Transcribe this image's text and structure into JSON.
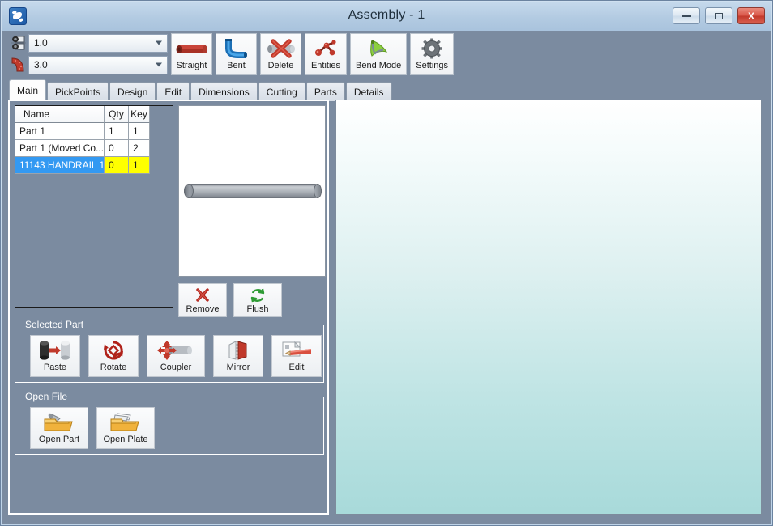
{
  "window": {
    "title": "Assembly - 1",
    "app_icon": "puzzle-piece-icon",
    "controls": {
      "minimize": "minimize-icon",
      "maximize": "restore-icon",
      "close": "X"
    }
  },
  "toolbar": {
    "combos": [
      {
        "icon": "pipe-diameter-icon",
        "value": "1.0"
      },
      {
        "icon": "bend-radius-icon",
        "value": "3.0"
      }
    ],
    "buttons": [
      {
        "label": "Straight",
        "icon": "straight-pipe-icon"
      },
      {
        "label": "Bent",
        "icon": "bent-pipe-icon"
      },
      {
        "label": "Delete",
        "icon": "delete-pipe-icon"
      },
      {
        "label": "Entities",
        "icon": "entities-nodes-icon"
      },
      {
        "label": "Bend Mode",
        "icon": "bend-mode-icon"
      },
      {
        "label": "Settings",
        "icon": "gear-icon"
      }
    ]
  },
  "tabs": [
    {
      "label": "Main",
      "active": true
    },
    {
      "label": "PickPoints",
      "active": false
    },
    {
      "label": "Design",
      "active": false
    },
    {
      "label": "Edit",
      "active": false
    },
    {
      "label": "Dimensions",
      "active": false
    },
    {
      "label": "Cutting",
      "active": false
    },
    {
      "label": "Parts",
      "active": false
    },
    {
      "label": "Details",
      "active": false
    }
  ],
  "parts_list": {
    "columns": [
      "Name",
      "Qty",
      "Key"
    ],
    "rows": [
      {
        "name": "Part 1",
        "qty": "1",
        "key": "1",
        "selected": false
      },
      {
        "name": "Part 1 (Moved Co...",
        "qty": "0",
        "key": "2",
        "selected": false
      },
      {
        "name": "11143 HANDRAIL 1",
        "qty": "0",
        "key": "1",
        "selected": true
      }
    ]
  },
  "preview": {
    "shape": "straight-pipe-preview"
  },
  "preview_buttons": [
    {
      "label": "Remove",
      "icon": "red-x-icon"
    },
    {
      "label": "Flush",
      "icon": "green-refresh-icon"
    }
  ],
  "selected_part_group": {
    "title": "Selected Part",
    "buttons": [
      {
        "label": "Paste",
        "icon": "paste-cylinder-icon"
      },
      {
        "label": "Rotate",
        "icon": "rotate-icon"
      },
      {
        "label": "Coupler",
        "icon": "coupler-icon"
      },
      {
        "label": "Mirror",
        "icon": "mirror-icon"
      },
      {
        "label": "Edit",
        "icon": "edit-pencil-icon"
      }
    ]
  },
  "open_file_group": {
    "title": "Open File",
    "buttons": [
      {
        "label": "Open Part",
        "icon": "open-folder-part-icon"
      },
      {
        "label": "Open Plate",
        "icon": "open-folder-plate-icon"
      }
    ]
  },
  "colors": {
    "panel_gray": "#7b8ba0",
    "titlebar_blue": "#b3cbe2",
    "selection_blue": "#3399f2",
    "highlight_yellow": "#ffff00",
    "canvas_top": "#ffffff",
    "canvas_bottom": "#a8dada",
    "accent_red": "#c0392b"
  }
}
